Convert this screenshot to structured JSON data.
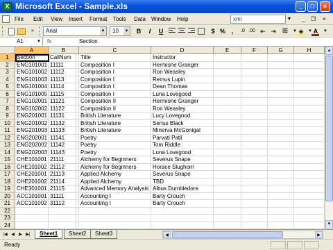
{
  "window": {
    "title": "Microsoft Excel - Sample.xls",
    "app_icon": "X"
  },
  "menu": [
    "File",
    "Edit",
    "View",
    "Insert",
    "Format",
    "Tools",
    "Data",
    "Window",
    "Help"
  ],
  "help_box": "xml",
  "toolbar": {
    "font": "Arial",
    "size": "10",
    "bold": "B",
    "italic": "I",
    "underline": "U",
    "currency": "$",
    "percent": "%",
    "comma": ",",
    "font_color": "#e00000",
    "fill_color": "#ffff00"
  },
  "formula_bar": {
    "name_box": "A1",
    "fx": "fx",
    "formula": "Section"
  },
  "columns": [
    "A",
    "B",
    "C",
    "D",
    "E",
    "F",
    "G",
    "H"
  ],
  "rows": [
    [
      "Section",
      "CallNum",
      "Title",
      "Instructor"
    ],
    [
      "ENG101001",
      "11111",
      "Composition I",
      "Hermione Granger"
    ],
    [
      "ENG101002",
      "11112",
      "Composition I",
      "Ron Weasley"
    ],
    [
      "ENG101003",
      "11113",
      "Composition I",
      "Remus Lupin"
    ],
    [
      "ENG101004",
      "11114",
      "Composition I",
      "Dean Thomas"
    ],
    [
      "ENG101005",
      "11115",
      "Composition I",
      "Luna Lovegood"
    ],
    [
      "ENG102001",
      "11121",
      "Composition II",
      "Hermione Granger"
    ],
    [
      "ENG102002",
      "11122",
      "Composition II",
      "Ron Weasley"
    ],
    [
      "ENG201001",
      "11131",
      "British Literature",
      "Lucy Lovegood"
    ],
    [
      "ENG201002",
      "11132",
      "British Literature",
      "Serius Black"
    ],
    [
      "ENG201003",
      "11133",
      "British Literature",
      "Minerva McGonigal"
    ],
    [
      "ENG202001",
      "11141",
      "Poetry",
      "Parvati Patil"
    ],
    [
      "ENG202002",
      "11142",
      "Poetry",
      "Tom Riddle"
    ],
    [
      "ENG202003",
      "11143",
      "Poetry",
      "Luna Lovegood"
    ],
    [
      "CHE101001",
      "21111",
      "Alchemy for Beginners",
      "Severus Snape"
    ],
    [
      "CHE101002",
      "21112",
      "Alchemy for Beginners",
      "Horace Slughorn"
    ],
    [
      "CHE201001",
      "21113",
      "Applied Alchemy",
      "Severus Snape"
    ],
    [
      "CHE201002",
      "21114",
      "Applied Alchemy",
      "TBD"
    ],
    [
      "CHE301001",
      "21115",
      "Advanced Memory Analysis",
      "Albus Dumbledore"
    ],
    [
      "ACC101001",
      "31111",
      "Accounting I",
      "Barty Crouch"
    ],
    [
      "ACC101002",
      "31112",
      "Accounting I",
      "Barty Crouch"
    ],
    [
      "",
      "",
      "",
      ""
    ],
    [
      "",
      "",
      "",
      ""
    ],
    [
      "",
      "",
      "",
      ""
    ],
    [
      "",
      "",
      "",
      ""
    ]
  ],
  "sheets": [
    "Sheet1",
    "Sheet2",
    "Sheet3"
  ],
  "status": "Ready"
}
